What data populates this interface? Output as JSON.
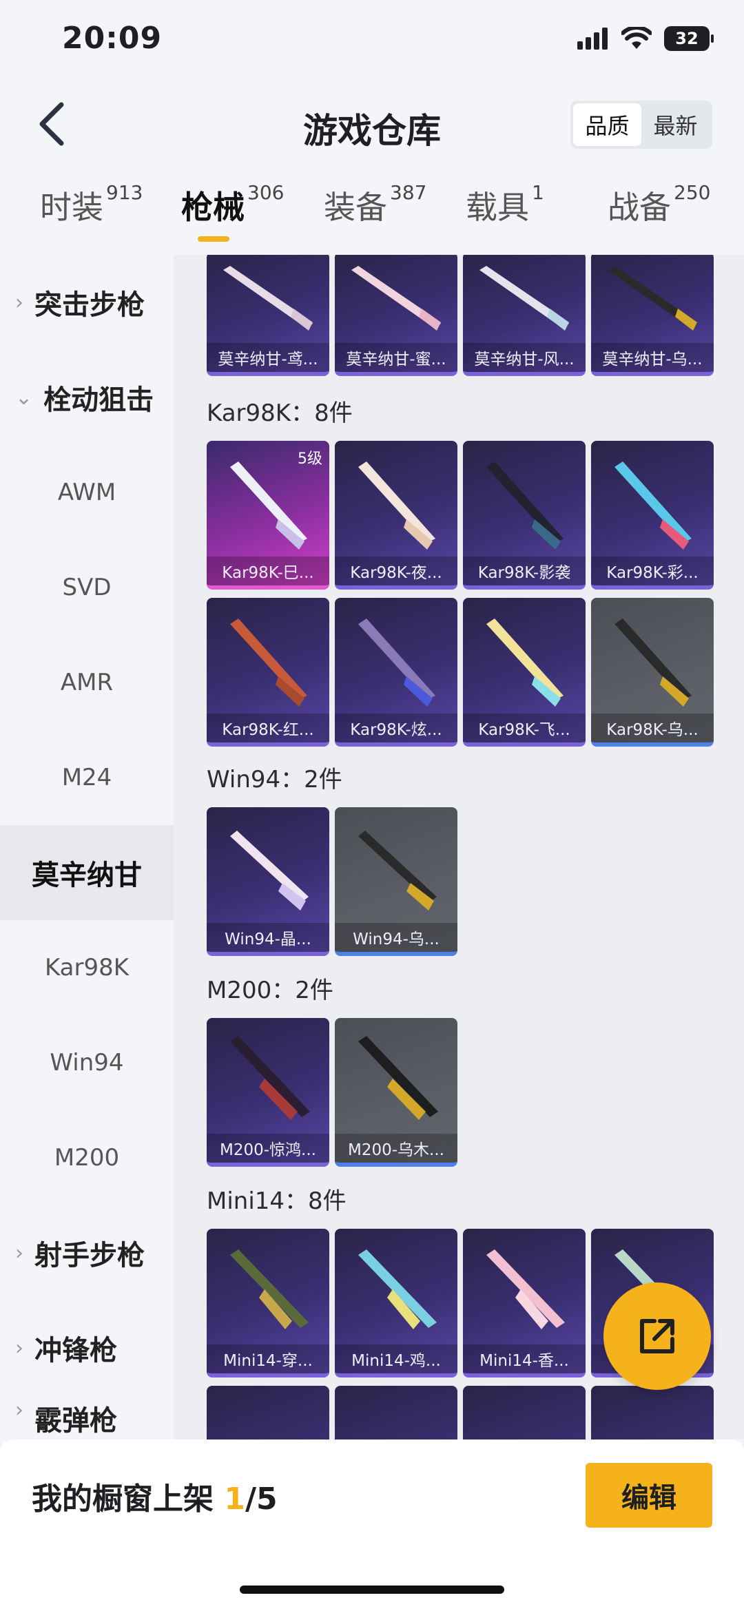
{
  "status": {
    "time": "20:09",
    "battery": "32"
  },
  "header": {
    "title": "游戏仓库",
    "sort_options": [
      "品质",
      "最新"
    ]
  },
  "tabs": [
    {
      "label": "时装",
      "count": "913"
    },
    {
      "label": "枪械",
      "count": "306"
    },
    {
      "label": "装备",
      "count": "387"
    },
    {
      "label": "载具",
      "count": "1"
    },
    {
      "label": "战备",
      "count": "250"
    }
  ],
  "sidebar": {
    "group_assault": "突击步枪",
    "group_sniper": "栓动狙击",
    "sub": [
      "AWM",
      "SVD",
      "AMR",
      "M24",
      "莫辛纳甘",
      "Kar98K",
      "Win94",
      "M200"
    ],
    "group_marksman": "射手步枪",
    "group_smg": "冲锋枪",
    "group_shotgun": "霰弹枪"
  },
  "sections": {
    "mosin_top": [
      "莫辛纳甘-鸢...",
      "莫辛纳甘-蜜...",
      "莫辛纳甘-风...",
      "莫辛纳甘-乌..."
    ],
    "kar98k": {
      "label": "Kar98K：8件",
      "level": "5级",
      "items": [
        "Kar98K-巳...",
        "Kar98K-夜...",
        "Kar98K-影袭",
        "Kar98K-彩...",
        "Kar98K-红...",
        "Kar98K-炫...",
        "Kar98K-飞...",
        "Kar98K-乌..."
      ]
    },
    "win94": {
      "label": "Win94：2件",
      "items": [
        "Win94-晶...",
        "Win94-乌..."
      ]
    },
    "m200": {
      "label": "M200：2件",
      "items": [
        "M200-惊鸿...",
        "M200-乌木..."
      ]
    },
    "mini14": {
      "label": "Mini14：8件",
      "items": [
        "Mini14-穿...",
        "Mini14-鸡...",
        "Mini14-香...",
        ""
      ]
    }
  },
  "bottom": {
    "prefix": "我的橱窗上架 ",
    "current": "1",
    "total": "/5",
    "edit": "编辑"
  }
}
